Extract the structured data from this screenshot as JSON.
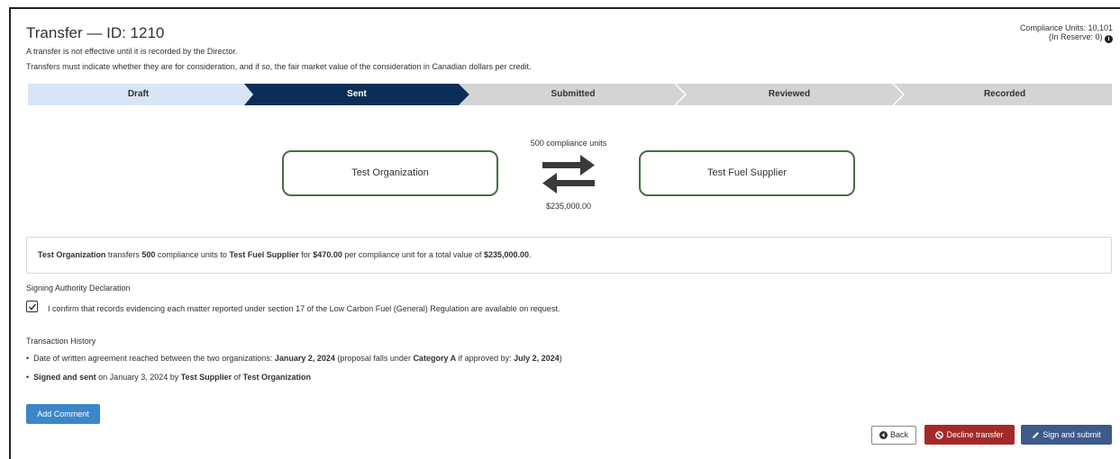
{
  "header": {
    "title": "Transfer — ID: 1210",
    "note1": "A transfer is not effective until it is recorded by the Director.",
    "note2": "Transfers must indicate whether they are for consideration, and if so, the fair market value of the consideration in Canadian dollars per credit.",
    "compliance_units": "Compliance Units: 10,101",
    "in_reserve": "(In Reserve: 0)",
    "info_icon": "info-circle-icon"
  },
  "progress": {
    "steps": [
      "Draft",
      "Sent",
      "Submitted",
      "Reviewed",
      "Recorded"
    ],
    "active_step": "Sent",
    "colors": {
      "completed": "#d8e5f6",
      "active": "#0b2e59",
      "pending": "#d4d4d4"
    }
  },
  "transfer": {
    "from_org": "Test Organization",
    "to_org": "Test Fuel Supplier",
    "units_label": "500 compliance units",
    "total_value": "$235,000.00",
    "exchange_icon": "exchange-arrows-icon"
  },
  "summary": {
    "from": "Test Organization",
    "t1": " transfers ",
    "units": "500",
    "t2": " compliance units to ",
    "to": "Test Fuel Supplier",
    "t3": " for ",
    "price": "$470.00",
    "t4": " per compliance unit for a total value of ",
    "total": "$235,000.00",
    "t5": "."
  },
  "declaration": {
    "heading": "Signing Authority Declaration",
    "text": "I confirm that records evidencing each matter reported under section 17 of the Low Carbon Fuel (General) Regulation are available on request.",
    "checked": true
  },
  "history": {
    "heading": "Transaction History",
    "item1": {
      "t1": "Date of written agreement reached between the two organizations: ",
      "date": "January 2, 2024",
      "t2": " (proposal falls under ",
      "category": "Category A",
      "t3": " if approved by: ",
      "approve_by": "July 2, 2024",
      "t4": ")"
    },
    "item2": {
      "action": "Signed and sent",
      "t1": " on January 3, 2024 by ",
      "user": "Test Supplier",
      "t2": " of ",
      "org": "Test Organization"
    }
  },
  "buttons": {
    "add_comment": "Add Comment",
    "back": "Back",
    "decline": "Decline transfer",
    "sign": "Sign and submit"
  }
}
